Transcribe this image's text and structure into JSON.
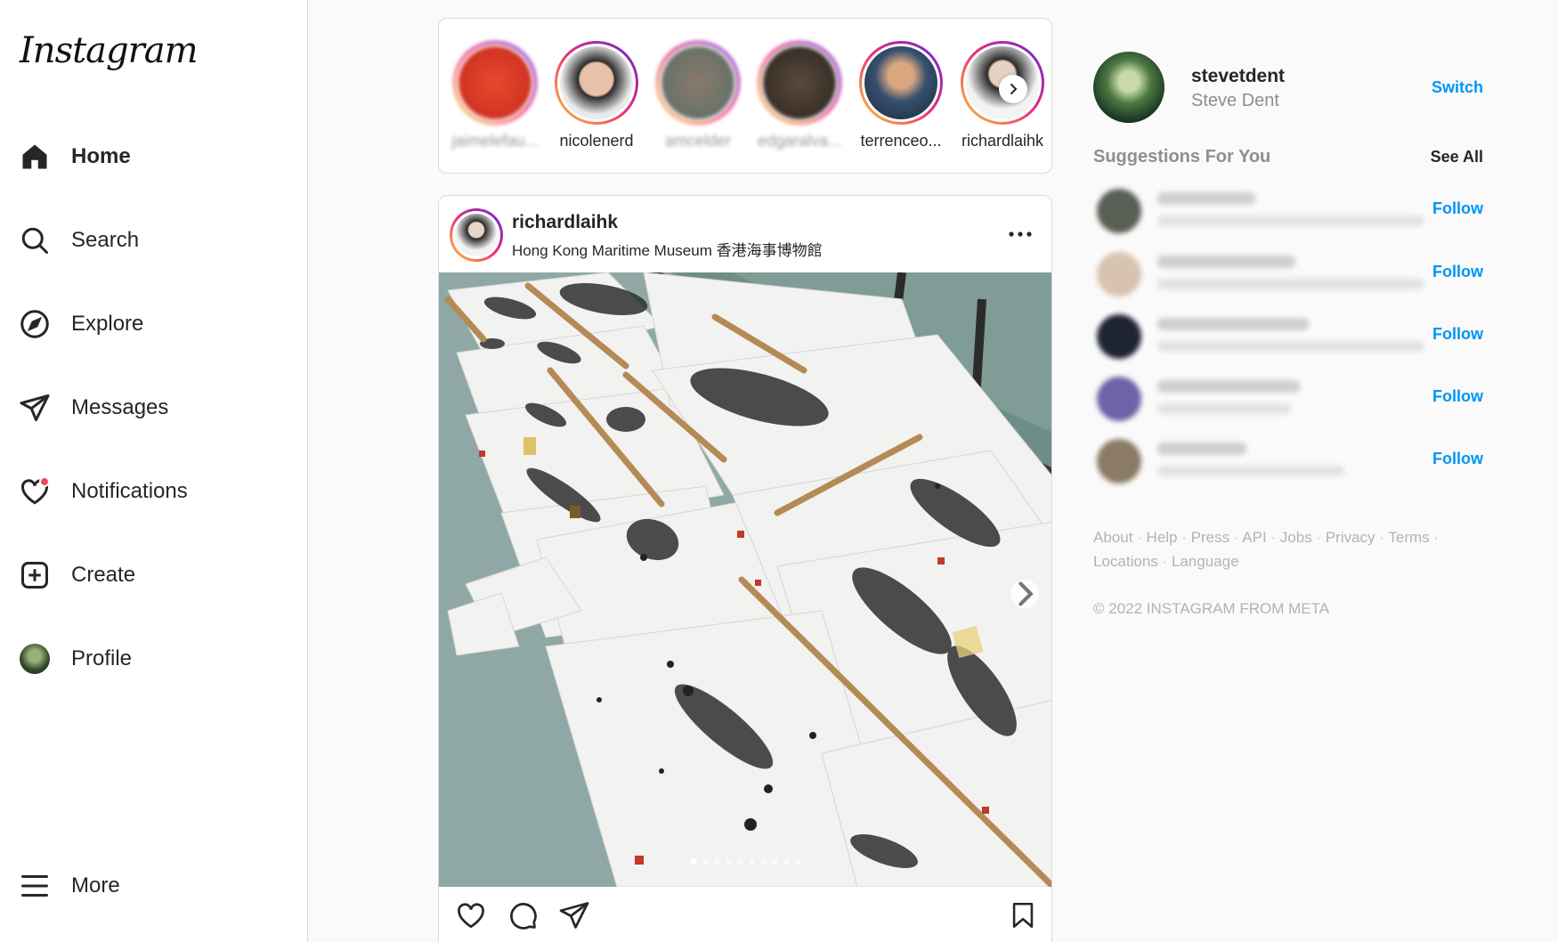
{
  "brand": {
    "logo": "Instagram"
  },
  "nav": {
    "items": [
      {
        "label": "Home",
        "icon": "home-icon"
      },
      {
        "label": "Search",
        "icon": "search-icon"
      },
      {
        "label": "Explore",
        "icon": "compass-icon"
      },
      {
        "label": "Messages",
        "icon": "paper-plane-icon"
      },
      {
        "label": "Notifications",
        "icon": "heart-icon"
      },
      {
        "label": "Create",
        "icon": "plus-square-icon"
      },
      {
        "label": "Profile",
        "icon": "avatar"
      }
    ],
    "more": "More"
  },
  "stories": [
    {
      "name": "jaimelefau...",
      "blurred": true
    },
    {
      "name": "nicolenerd",
      "blurred": false
    },
    {
      "name": "amcelder",
      "blurred": true
    },
    {
      "name": "edgaralva...",
      "blurred": true
    },
    {
      "name": "terrenceo...",
      "blurred": false
    },
    {
      "name": "richardlaihk",
      "blurred": false
    }
  ],
  "post": {
    "username": "richardlaihk",
    "location": "Hong Kong Maritime Museum 香港海事博物館",
    "image_count": 10,
    "current_image": 1
  },
  "account": {
    "username": "stevetdent",
    "display_name": "Steve Dent",
    "switch_label": "Switch"
  },
  "suggestions": {
    "title": "Suggestions For You",
    "see_all": "See All",
    "follow_label": "Follow",
    "count": 5
  },
  "footer": {
    "links": [
      "About",
      "Help",
      "Press",
      "API",
      "Jobs",
      "Privacy",
      "Terms",
      "Locations",
      "Language"
    ],
    "copyright": "© 2022 INSTAGRAM FROM META"
  },
  "colors": {
    "accent": "#0095f6",
    "notification_dot": "#ed4956",
    "border": "#dbdbdb",
    "secondary_text": "#8e8e8e"
  }
}
